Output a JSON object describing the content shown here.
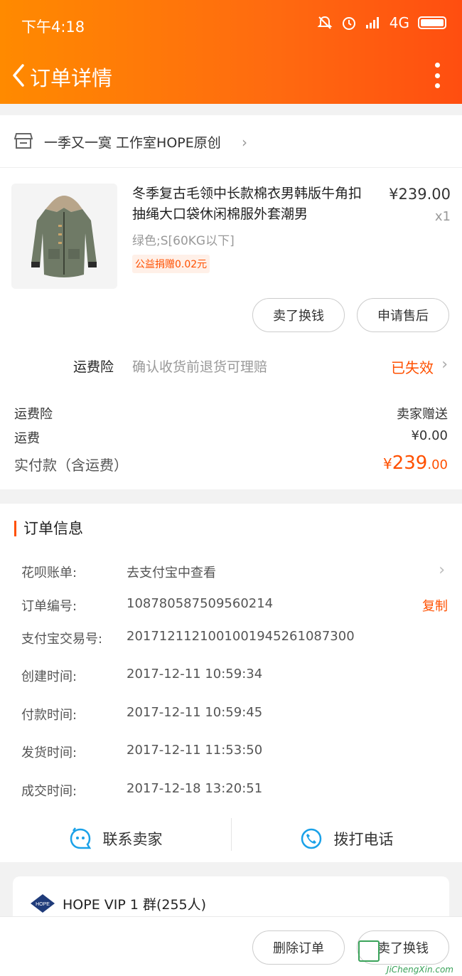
{
  "status_bar": {
    "time": "下午4:18",
    "network": "4G"
  },
  "nav": {
    "title": "订单详情"
  },
  "shop": {
    "name": "一季又一寞 工作室HOPE原创"
  },
  "product": {
    "title": "冬季复古毛领中长款棉衣男韩版牛角扣抽绳大口袋休闲棉服外套潮男",
    "price": "¥239.00",
    "qty": "x1",
    "spec": "绿色;S[60KG以下]",
    "charity": "公益捐赠0.02元"
  },
  "actions": {
    "sell_label": "卖了换钱",
    "after_sale_label": "申请售后"
  },
  "insurance": {
    "label": "运费险",
    "desc": "确认收货前退货可理赔",
    "status": "已失效"
  },
  "fees": {
    "insurance_label": "运费险",
    "insurance_value": "卖家赠送",
    "shipping_label": "运费",
    "shipping_value": "¥0.00",
    "total_label": "实付款（含运费）",
    "total_currency": "¥",
    "total_int": "239",
    "total_dec": ".00"
  },
  "order_info": {
    "header": "订单信息",
    "huabei_label": "花呗账单:",
    "huabei_value": "去支付宝中查看",
    "order_no_label": "订单编号:",
    "order_no_value": "108780587509560214",
    "copy_label": "复制",
    "alipay_label": "支付宝交易号:",
    "alipay_value": "2017121121001001945261087300",
    "created_label": "创建时间:",
    "created_value": "2017-12-11 10:59:34",
    "paid_label": "付款时间:",
    "paid_value": "2017-12-11 10:59:45",
    "shipped_label": "发货时间:",
    "shipped_value": "2017-12-11 11:53:50",
    "closed_label": "成交时间:",
    "closed_value": "2017-12-18 13:20:51"
  },
  "contact": {
    "seller_label": "联系卖家",
    "phone_label": "拨打电话"
  },
  "group": {
    "name": "HOPE VIP 1 群(255人)",
    "logo_text": "HOPE"
  },
  "bottom": {
    "delete_label": "删除订单",
    "sell_label": "卖了换钱"
  },
  "watermark": {
    "text": "JiChengXin.com"
  },
  "colors": {
    "accent": "#ff5000",
    "header_start": "#ff8a00",
    "header_end": "#ff4e10",
    "contact_icon": "#1aa1e8"
  }
}
